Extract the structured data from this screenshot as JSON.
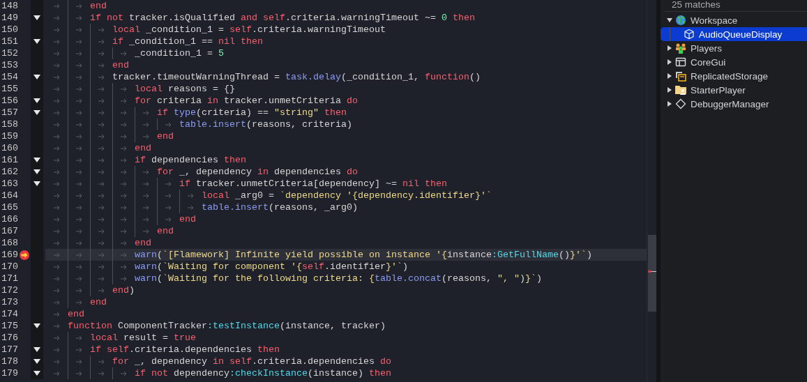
{
  "editor": {
    "lines": [
      {
        "number": "148",
        "indent": [
          {
            "guide": false
          },
          {
            "guide": true
          }
        ],
        "foldable": false,
        "breakpoint": false,
        "current": false,
        "tokens": [
          {
            "kind": "kw",
            "text": "end"
          }
        ]
      },
      {
        "number": "149",
        "indent": [
          {
            "guide": false
          },
          {
            "guide": true
          }
        ],
        "foldable": true,
        "breakpoint": false,
        "current": false,
        "tokens": [
          {
            "kind": "kw",
            "text": "if "
          },
          {
            "kind": "kw",
            "text": "not"
          },
          {
            "kind": "id",
            "text": " tracker.isQualified "
          },
          {
            "kind": "kw",
            "text": "and "
          },
          {
            "kind": "kw",
            "text": "self"
          },
          {
            "kind": "id",
            "text": ".criteria.warningTimeout ~= "
          },
          {
            "kind": "num",
            "text": "0"
          },
          {
            "kind": "kw",
            "text": " then"
          }
        ]
      },
      {
        "number": "150",
        "indent": [
          {
            "guide": false
          },
          {
            "guide": true
          },
          {
            "guide": true
          }
        ],
        "foldable": false,
        "breakpoint": false,
        "current": false,
        "tokens": [
          {
            "kind": "kw",
            "text": "local"
          },
          {
            "kind": "id",
            "text": " _condition_1 = "
          },
          {
            "kind": "kw",
            "text": "self"
          },
          {
            "kind": "id",
            "text": ".criteria.warningTimeout"
          }
        ]
      },
      {
        "number": "151",
        "indent": [
          {
            "guide": false
          },
          {
            "guide": true
          },
          {
            "guide": true
          }
        ],
        "foldable": true,
        "breakpoint": false,
        "current": false,
        "tokens": [
          {
            "kind": "kw",
            "text": "if"
          },
          {
            "kind": "id",
            "text": " _condition_1 == "
          },
          {
            "kind": "kw",
            "text": "nil then"
          }
        ]
      },
      {
        "number": "152",
        "indent": [
          {
            "guide": false
          },
          {
            "guide": true
          },
          {
            "guide": true
          },
          {
            "guide": true
          }
        ],
        "foldable": false,
        "breakpoint": false,
        "current": false,
        "tokens": [
          {
            "kind": "id",
            "text": "_condition_1 = "
          },
          {
            "kind": "num",
            "text": "5"
          }
        ]
      },
      {
        "number": "153",
        "indent": [
          {
            "guide": false
          },
          {
            "guide": true
          },
          {
            "guide": true
          }
        ],
        "foldable": false,
        "breakpoint": false,
        "current": false,
        "tokens": [
          {
            "kind": "kw",
            "text": "end"
          }
        ]
      },
      {
        "number": "154",
        "indent": [
          {
            "guide": false
          },
          {
            "guide": true
          },
          {
            "guide": true
          }
        ],
        "foldable": true,
        "breakpoint": false,
        "current": false,
        "tokens": [
          {
            "kind": "id",
            "text": "tracker.timeoutWarningThread = "
          },
          {
            "kind": "fn",
            "text": "task.delay"
          },
          {
            "kind": "id",
            "text": "(_condition_1, "
          },
          {
            "kind": "kw",
            "text": "function"
          },
          {
            "kind": "id",
            "text": "()"
          }
        ]
      },
      {
        "number": "155",
        "indent": [
          {
            "guide": false
          },
          {
            "guide": true
          },
          {
            "guide": true
          },
          {
            "guide": true
          }
        ],
        "foldable": false,
        "breakpoint": false,
        "current": false,
        "tokens": [
          {
            "kind": "kw",
            "text": "local"
          },
          {
            "kind": "id",
            "text": " reasons = {}"
          }
        ]
      },
      {
        "number": "156",
        "indent": [
          {
            "guide": false
          },
          {
            "guide": true
          },
          {
            "guide": true
          },
          {
            "guide": true
          }
        ],
        "foldable": true,
        "breakpoint": false,
        "current": false,
        "tokens": [
          {
            "kind": "kw",
            "text": "for"
          },
          {
            "kind": "id",
            "text": " criteria "
          },
          {
            "kind": "kw",
            "text": "in"
          },
          {
            "kind": "id",
            "text": " tracker.unmetCriteria "
          },
          {
            "kind": "kw",
            "text": "do"
          }
        ]
      },
      {
        "number": "157",
        "indent": [
          {
            "guide": false
          },
          {
            "guide": true
          },
          {
            "guide": true
          },
          {
            "guide": true
          },
          {
            "guide": true
          }
        ],
        "foldable": true,
        "breakpoint": false,
        "current": false,
        "tokens": [
          {
            "kind": "kw",
            "text": "if "
          },
          {
            "kind": "fn",
            "text": "type"
          },
          {
            "kind": "id",
            "text": "(criteria) == "
          },
          {
            "kind": "str",
            "text": "\"string\""
          },
          {
            "kind": "kw",
            "text": " then"
          }
        ]
      },
      {
        "number": "158",
        "indent": [
          {
            "guide": false
          },
          {
            "guide": true
          },
          {
            "guide": true
          },
          {
            "guide": true
          },
          {
            "guide": true
          },
          {
            "guide": true
          }
        ],
        "foldable": false,
        "breakpoint": false,
        "current": false,
        "tokens": [
          {
            "kind": "fn",
            "text": "table.insert"
          },
          {
            "kind": "id",
            "text": "(reasons, criteria)"
          }
        ]
      },
      {
        "number": "159",
        "indent": [
          {
            "guide": false
          },
          {
            "guide": true
          },
          {
            "guide": true
          },
          {
            "guide": true
          },
          {
            "guide": true
          }
        ],
        "foldable": false,
        "breakpoint": false,
        "current": false,
        "tokens": [
          {
            "kind": "kw",
            "text": "end"
          }
        ]
      },
      {
        "number": "160",
        "indent": [
          {
            "guide": false
          },
          {
            "guide": true
          },
          {
            "guide": true
          },
          {
            "guide": true
          }
        ],
        "foldable": false,
        "breakpoint": false,
        "current": false,
        "tokens": [
          {
            "kind": "kw",
            "text": "end"
          }
        ]
      },
      {
        "number": "161",
        "indent": [
          {
            "guide": false
          },
          {
            "guide": true
          },
          {
            "guide": true
          },
          {
            "guide": true
          }
        ],
        "foldable": true,
        "breakpoint": false,
        "current": false,
        "tokens": [
          {
            "kind": "kw",
            "text": "if"
          },
          {
            "kind": "id",
            "text": " dependencies "
          },
          {
            "kind": "kw",
            "text": "then"
          }
        ]
      },
      {
        "number": "162",
        "indent": [
          {
            "guide": false
          },
          {
            "guide": true
          },
          {
            "guide": true
          },
          {
            "guide": true
          },
          {
            "guide": true
          }
        ],
        "foldable": true,
        "breakpoint": false,
        "current": false,
        "tokens": [
          {
            "kind": "kw",
            "text": "for"
          },
          {
            "kind": "id",
            "text": " _, dependency "
          },
          {
            "kind": "kw",
            "text": "in"
          },
          {
            "kind": "id",
            "text": " dependencies "
          },
          {
            "kind": "kw",
            "text": "do"
          }
        ]
      },
      {
        "number": "163",
        "indent": [
          {
            "guide": false
          },
          {
            "guide": true
          },
          {
            "guide": true
          },
          {
            "guide": true
          },
          {
            "guide": true
          },
          {
            "guide": true
          }
        ],
        "foldable": true,
        "breakpoint": false,
        "current": false,
        "tokens": [
          {
            "kind": "kw",
            "text": "if"
          },
          {
            "kind": "id",
            "text": " tracker.unmetCriteria[dependency] ~= "
          },
          {
            "kind": "kw",
            "text": "nil then"
          }
        ]
      },
      {
        "number": "164",
        "indent": [
          {
            "guide": false
          },
          {
            "guide": true
          },
          {
            "guide": true
          },
          {
            "guide": true
          },
          {
            "guide": true
          },
          {
            "guide": true
          },
          {
            "guide": true
          }
        ],
        "foldable": false,
        "breakpoint": false,
        "current": false,
        "tokens": [
          {
            "kind": "kw",
            "text": "local"
          },
          {
            "kind": "id",
            "text": " _arg0 = "
          },
          {
            "kind": "str",
            "text": "`dependency '{dependency.identifier}'`"
          }
        ]
      },
      {
        "number": "165",
        "indent": [
          {
            "guide": false
          },
          {
            "guide": true
          },
          {
            "guide": true
          },
          {
            "guide": true
          },
          {
            "guide": true
          },
          {
            "guide": true
          },
          {
            "guide": true
          }
        ],
        "foldable": false,
        "breakpoint": false,
        "current": false,
        "tokens": [
          {
            "kind": "fn",
            "text": "table.insert"
          },
          {
            "kind": "id",
            "text": "(reasons, _arg0)"
          }
        ]
      },
      {
        "number": "166",
        "indent": [
          {
            "guide": false
          },
          {
            "guide": true
          },
          {
            "guide": true
          },
          {
            "guide": true
          },
          {
            "guide": true
          },
          {
            "guide": true
          }
        ],
        "foldable": false,
        "breakpoint": false,
        "current": false,
        "tokens": [
          {
            "kind": "kw",
            "text": "end"
          }
        ]
      },
      {
        "number": "167",
        "indent": [
          {
            "guide": false
          },
          {
            "guide": true
          },
          {
            "guide": true
          },
          {
            "guide": true
          },
          {
            "guide": true
          }
        ],
        "foldable": false,
        "breakpoint": false,
        "current": false,
        "tokens": [
          {
            "kind": "kw",
            "text": "end"
          }
        ]
      },
      {
        "number": "168",
        "indent": [
          {
            "guide": false
          },
          {
            "guide": true
          },
          {
            "guide": true
          },
          {
            "guide": true
          }
        ],
        "foldable": false,
        "breakpoint": false,
        "current": false,
        "tokens": [
          {
            "kind": "kw",
            "text": "end"
          }
        ]
      },
      {
        "number": "169",
        "indent": [
          {
            "guide": false
          },
          {
            "guide": true
          },
          {
            "guide": true
          },
          {
            "guide": true
          }
        ],
        "foldable": false,
        "breakpoint": true,
        "current": true,
        "tokens": [
          {
            "kind": "fn",
            "text": "warn"
          },
          {
            "kind": "id",
            "text": "("
          },
          {
            "kind": "str",
            "text": "`[Flamework] Infinite yield possible on instance '{"
          },
          {
            "kind": "id",
            "text": "instance"
          },
          {
            "kind": "meth",
            "text": ":GetFullName"
          },
          {
            "kind": "id",
            "text": "()"
          },
          {
            "kind": "str",
            "text": "}'`"
          },
          {
            "kind": "id",
            "text": ")"
          }
        ]
      },
      {
        "number": "170",
        "indent": [
          {
            "guide": false
          },
          {
            "guide": true
          },
          {
            "guide": true
          },
          {
            "guide": true
          }
        ],
        "foldable": false,
        "breakpoint": false,
        "current": false,
        "tokens": [
          {
            "kind": "fn",
            "text": "warn"
          },
          {
            "kind": "id",
            "text": "("
          },
          {
            "kind": "str",
            "text": "`Waiting for component '{"
          },
          {
            "kind": "kw",
            "text": "self"
          },
          {
            "kind": "id",
            "text": ".identifier"
          },
          {
            "kind": "str",
            "text": "}'`"
          },
          {
            "kind": "id",
            "text": ")"
          }
        ]
      },
      {
        "number": "171",
        "indent": [
          {
            "guide": false
          },
          {
            "guide": true
          },
          {
            "guide": true
          },
          {
            "guide": true
          }
        ],
        "foldable": false,
        "breakpoint": false,
        "current": false,
        "tokens": [
          {
            "kind": "fn",
            "text": "warn"
          },
          {
            "kind": "id",
            "text": "("
          },
          {
            "kind": "str",
            "text": "`Waiting for the following criteria: {"
          },
          {
            "kind": "fn",
            "text": "table.concat"
          },
          {
            "kind": "id",
            "text": "(reasons, "
          },
          {
            "kind": "str",
            "text": "\", \""
          },
          {
            "kind": "id",
            "text": ")"
          },
          {
            "kind": "str",
            "text": "}`"
          },
          {
            "kind": "id",
            "text": ")"
          }
        ]
      },
      {
        "number": "172",
        "indent": [
          {
            "guide": false
          },
          {
            "guide": true
          },
          {
            "guide": true
          }
        ],
        "foldable": false,
        "breakpoint": false,
        "current": false,
        "tokens": [
          {
            "kind": "kw",
            "text": "end"
          },
          {
            "kind": "id",
            "text": ")"
          }
        ]
      },
      {
        "number": "173",
        "indent": [
          {
            "guide": false
          },
          {
            "guide": true
          }
        ],
        "foldable": false,
        "breakpoint": false,
        "current": false,
        "tokens": [
          {
            "kind": "kw",
            "text": "end"
          }
        ]
      },
      {
        "number": "174",
        "indent": [
          {
            "guide": false
          }
        ],
        "foldable": false,
        "breakpoint": false,
        "current": false,
        "tokens": [
          {
            "kind": "kw",
            "text": "end"
          }
        ]
      },
      {
        "number": "175",
        "indent": [
          {
            "guide": false
          }
        ],
        "foldable": true,
        "breakpoint": false,
        "current": false,
        "tokens": [
          {
            "kind": "kw",
            "text": "function"
          },
          {
            "kind": "id",
            "text": " ComponentTracker"
          },
          {
            "kind": "meth",
            "text": ":testInstance"
          },
          {
            "kind": "id",
            "text": "(instance, tracker)"
          }
        ]
      },
      {
        "number": "176",
        "indent": [
          {
            "guide": false
          },
          {
            "guide": true
          }
        ],
        "foldable": false,
        "breakpoint": false,
        "current": false,
        "tokens": [
          {
            "kind": "kw",
            "text": "local"
          },
          {
            "kind": "id",
            "text": " result = "
          },
          {
            "kind": "kw",
            "text": "true"
          }
        ]
      },
      {
        "number": "177",
        "indent": [
          {
            "guide": false
          },
          {
            "guide": true
          }
        ],
        "foldable": true,
        "breakpoint": false,
        "current": false,
        "tokens": [
          {
            "kind": "kw",
            "text": "if self"
          },
          {
            "kind": "id",
            "text": ".criteria.dependencies "
          },
          {
            "kind": "kw",
            "text": "then"
          }
        ]
      },
      {
        "number": "178",
        "indent": [
          {
            "guide": false
          },
          {
            "guide": true
          },
          {
            "guide": true
          }
        ],
        "foldable": true,
        "breakpoint": false,
        "current": false,
        "tokens": [
          {
            "kind": "kw",
            "text": "for"
          },
          {
            "kind": "id",
            "text": " _, dependency "
          },
          {
            "kind": "kw",
            "text": "in self"
          },
          {
            "kind": "id",
            "text": ".criteria.dependencies "
          },
          {
            "kind": "kw",
            "text": "do"
          }
        ]
      },
      {
        "number": "179",
        "indent": [
          {
            "guide": false
          },
          {
            "guide": true
          },
          {
            "guide": true
          },
          {
            "guide": true
          }
        ],
        "foldable": true,
        "breakpoint": false,
        "current": false,
        "tokens": [
          {
            "kind": "kw",
            "text": "if not"
          },
          {
            "kind": "id",
            "text": " dependency"
          },
          {
            "kind": "meth",
            "text": ":checkInstance"
          },
          {
            "kind": "id",
            "text": "(instance) "
          },
          {
            "kind": "kw",
            "text": "then"
          }
        ]
      }
    ]
  },
  "explorer": {
    "match_count": "25 matches",
    "tree": [
      {
        "label": "Workspace",
        "expanded": true,
        "selected": false,
        "children": [
          {
            "label": "AudioQueueDisplay",
            "selected": true
          }
        ]
      },
      {
        "label": "Players",
        "expanded": false,
        "selected": false
      },
      {
        "label": "CoreGui",
        "expanded": false,
        "selected": false
      },
      {
        "label": "ReplicatedStorage",
        "expanded": false,
        "selected": false
      },
      {
        "label": "StarterPlayer",
        "expanded": false,
        "selected": false
      },
      {
        "label": "DebuggerManager",
        "expanded": false,
        "selected": false
      }
    ]
  }
}
